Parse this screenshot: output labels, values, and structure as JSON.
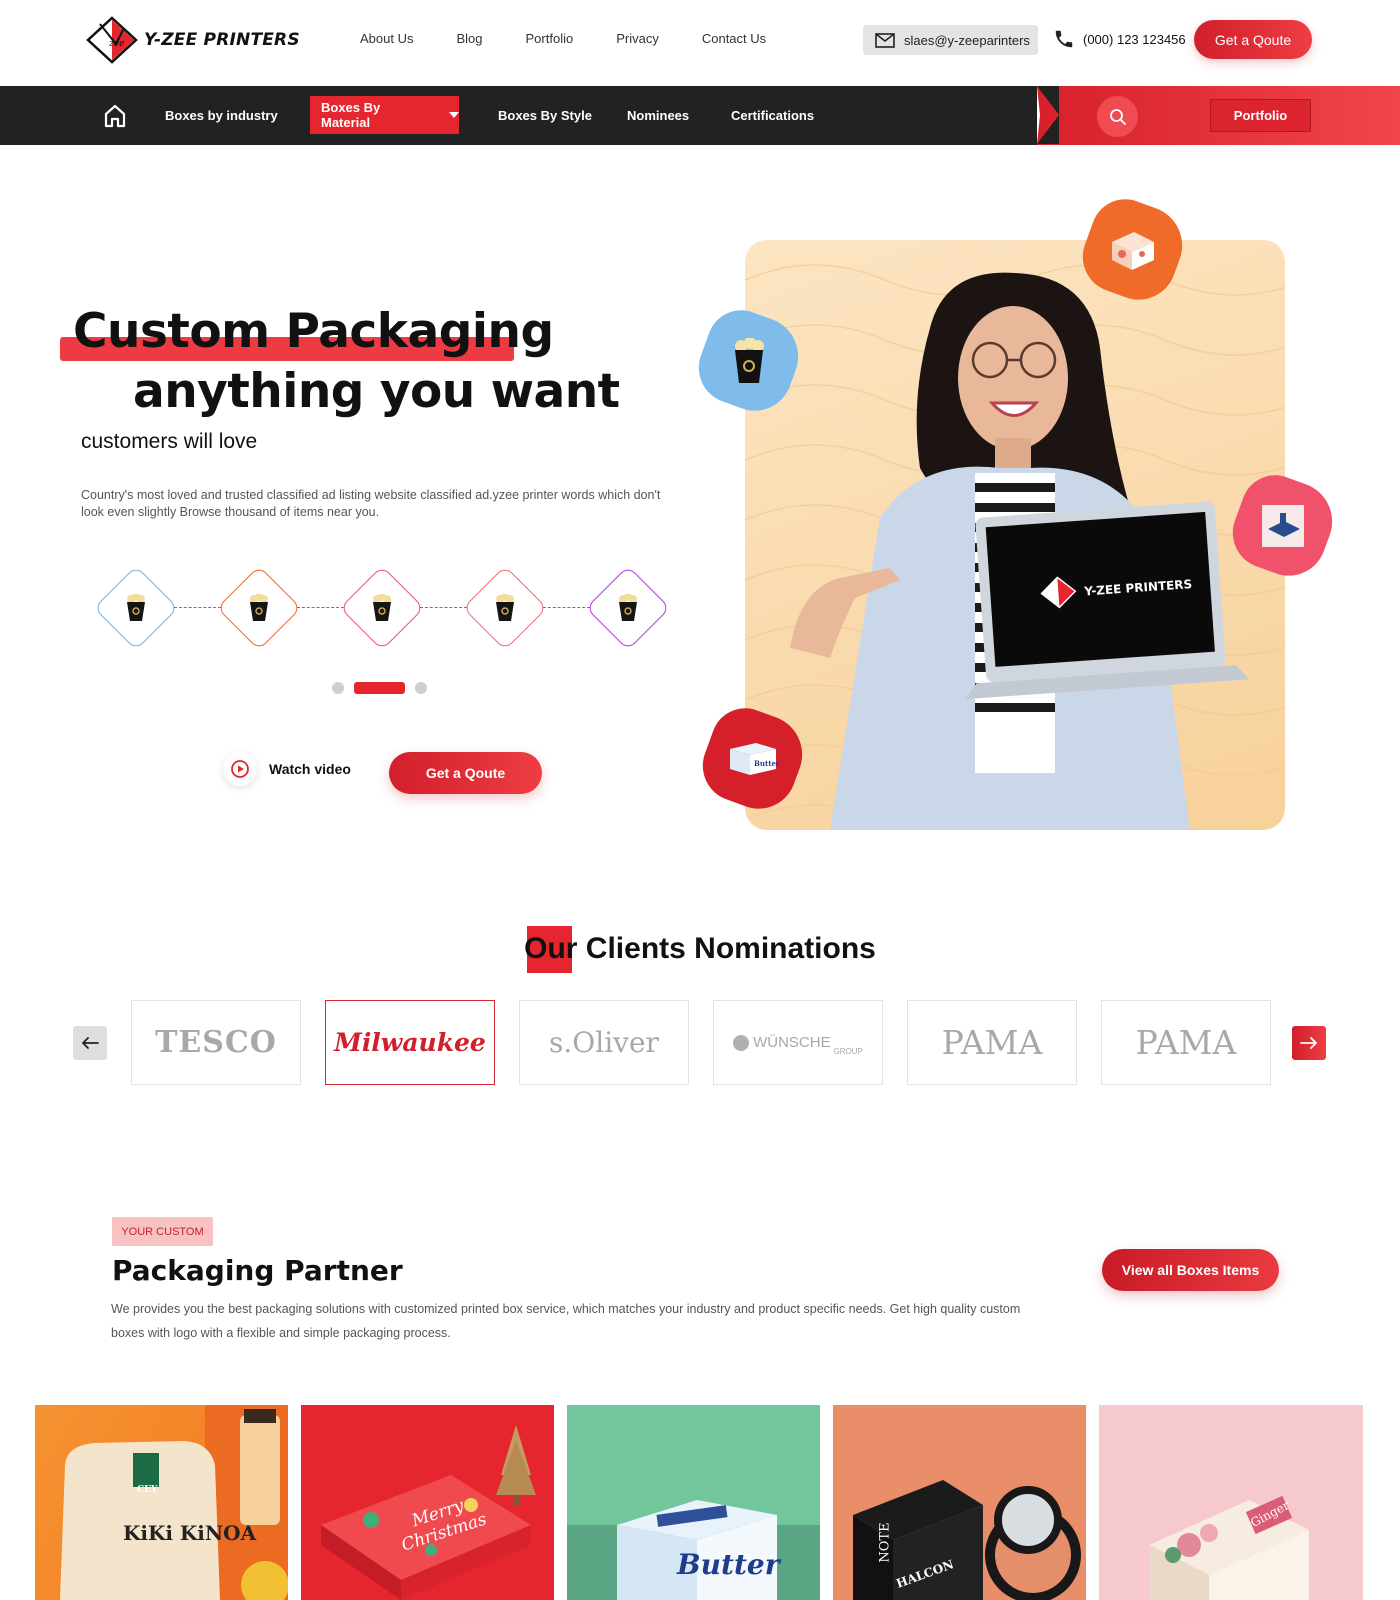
{
  "brand": {
    "name": "Y-ZEE PRINTERS"
  },
  "topnav": {
    "items": [
      "About Us",
      "Blog",
      "Portfolio",
      "Privacy",
      "Contact Us"
    ]
  },
  "contact": {
    "email": "slaes@y-zeeparinters",
    "phone": "(000) 123 123456"
  },
  "header": {
    "quote_label": "Get a Qoute"
  },
  "catnav": {
    "items": [
      "Boxes by industry",
      "Boxes By Material",
      "Boxes By Style",
      "Nominees",
      "Certifications"
    ],
    "active": "Boxes By Material",
    "portfolio_label": "Portfolio"
  },
  "hero": {
    "title_line1": "Custom Packaging",
    "title_line2": "anything you want",
    "subtitle": "customers will love",
    "description": "Country's most loved and trusted classified ad listing website classified ad.yzee printer words which don't look even slightly Browse thousand of items near you.",
    "step_colors": [
      "#6fb3e6",
      "#f06a2a",
      "#f0516b",
      "#f06a7a",
      "#b23ae0"
    ],
    "carousel": {
      "pages": 3,
      "active_page": 2
    },
    "watch_label": "Watch video",
    "quote_label": "Get a Qoute",
    "laptop_brand": "Y-ZEE PRINTERS"
  },
  "clients": {
    "title_strong": "Our Clients",
    "title_rest": " Nominations",
    "logos": [
      {
        "name": "TESCO",
        "active": false
      },
      {
        "name": "Milwaukee",
        "active": true
      },
      {
        "name": "s.Oliver",
        "active": false
      },
      {
        "name": "WÜNSCHE",
        "sub": "GROUP",
        "active": false
      },
      {
        "name": "PAMA",
        "active": false
      },
      {
        "name": "PAMA",
        "active": false
      }
    ]
  },
  "partner": {
    "tag": "YOUR CUSTOM",
    "title": "Packaging Partner",
    "description": "We provides you the best packaging solutions with customized printed box service, which matches your industry and product specific needs. Get high quality custom boxes with logo with a flexible and simple packaging process.",
    "cta": "View all Boxes Items"
  },
  "products": [
    {
      "label": "KiKi KiNOA",
      "sub": "CEY"
    },
    {
      "label": "Merry Christmas"
    },
    {
      "label": "Butter"
    },
    {
      "label": "HALCON",
      "sub": "NOTE"
    },
    {
      "label": "Ginger"
    }
  ],
  "colors": {
    "accent": "#e5262f",
    "dark": "#222222",
    "muted": "#555555"
  }
}
